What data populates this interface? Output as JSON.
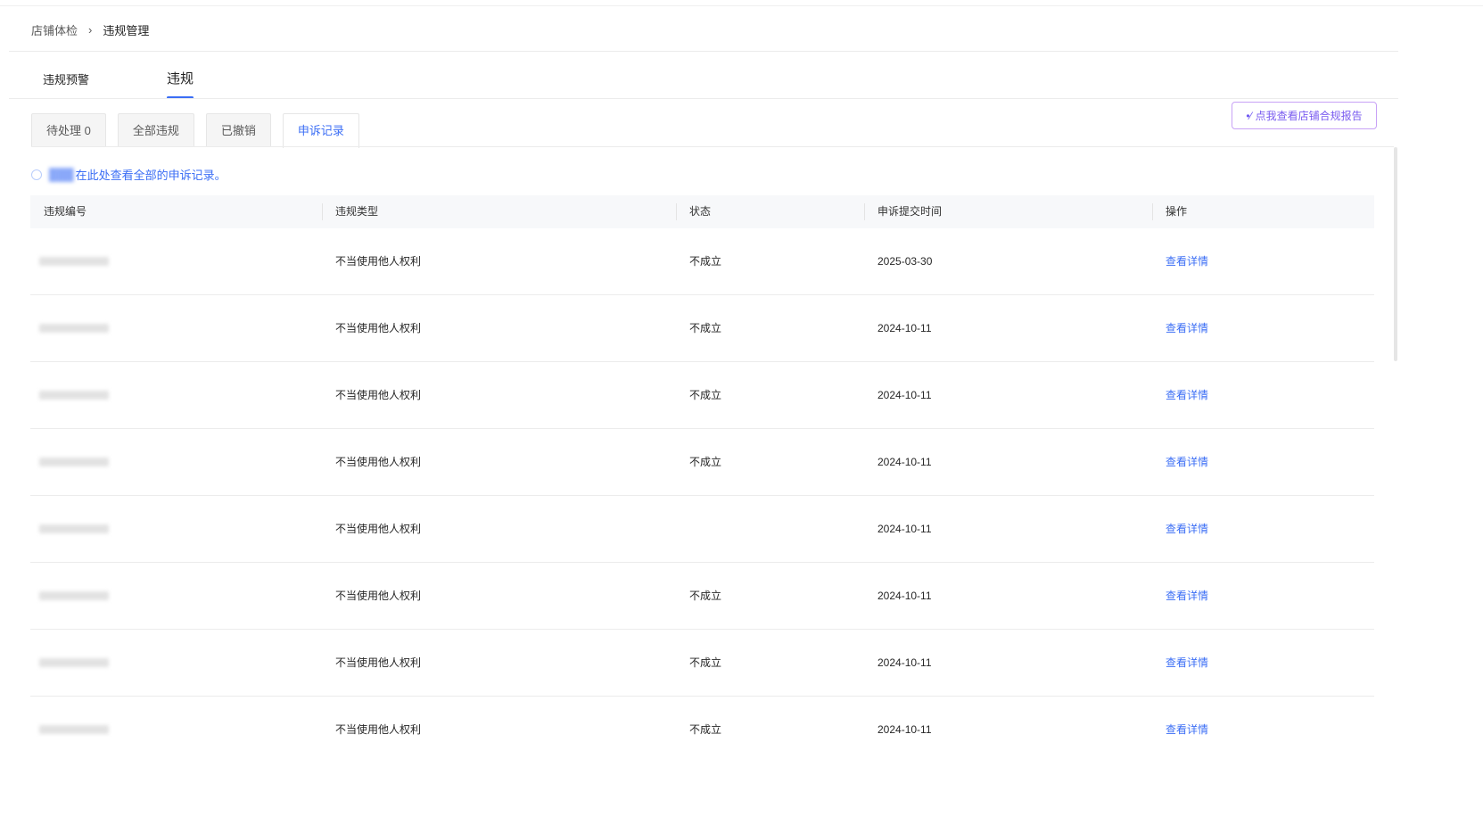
{
  "breadcrumb": {
    "parent": "店铺体检",
    "separator": "›",
    "current": "违规管理"
  },
  "main_tabs": [
    {
      "label": "违规预警",
      "active": false
    },
    {
      "label": "违规",
      "active": true
    }
  ],
  "sub_tabs": [
    {
      "label": "待处理 0",
      "active": false
    },
    {
      "label": "全部违规",
      "active": false
    },
    {
      "label": "已撤销",
      "active": false
    },
    {
      "label": "申诉记录",
      "active": true
    }
  ],
  "report_button": {
    "label": "点我查看店铺合规报告",
    "icon": "sparkle-icon"
  },
  "notice": {
    "text": "在此处查看全部的申诉记录。"
  },
  "table": {
    "columns": [
      "违规编号",
      "违规类型",
      "状态",
      "申诉提交时间",
      "操作"
    ],
    "rows": [
      {
        "type": "不当使用他人权利",
        "status": "不成立",
        "date": "2025-03-30",
        "action": "查看详情"
      },
      {
        "type": "不当使用他人权利",
        "status": "不成立",
        "date": "2024-10-11",
        "action": "查看详情"
      },
      {
        "type": "不当使用他人权利",
        "status": "不成立",
        "date": "2024-10-11",
        "action": "查看详情"
      },
      {
        "type": "不当使用他人权利",
        "status": "不成立",
        "date": "2024-10-11",
        "action": "查看详情"
      },
      {
        "type": "不当使用他人权利",
        "status": "",
        "date": "2024-10-11",
        "action": "查看详情"
      },
      {
        "type": "不当使用他人权利",
        "status": "不成立",
        "date": "2024-10-11",
        "action": "查看详情"
      },
      {
        "type": "不当使用他人权利",
        "status": "不成立",
        "date": "2024-10-11",
        "action": "查看详情"
      },
      {
        "type": "不当使用他人权利",
        "status": "不成立",
        "date": "2024-10-11",
        "action": "查看详情"
      }
    ]
  },
  "colors": {
    "accent": "#3b6ef5",
    "report_border": "#c8a2f6",
    "report_text": "#7a5cf0"
  }
}
